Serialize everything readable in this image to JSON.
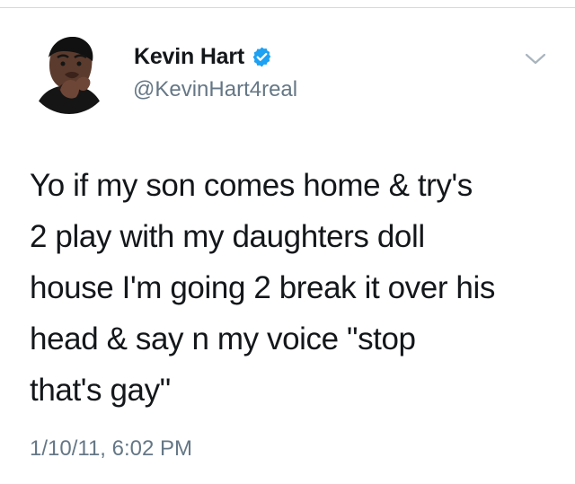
{
  "tweet": {
    "author": {
      "display_name": "Kevin Hart",
      "handle": "@KevinHart4real",
      "verified": true,
      "avatar_icon": "profile-photo-avatar"
    },
    "text": "Yo if my son comes home & try's\n2 play with my daughters doll\nhouse I'm going 2 break it over his\nhead & say n my voice \"stop\nthat's gay\"",
    "timestamp": "1/10/11, 6:02 PM",
    "icons": {
      "verified": "verified-badge-icon",
      "menu": "chevron-down-icon"
    },
    "colors": {
      "verified_badge": "#1da1f2",
      "secondary_text": "#657786",
      "primary_text": "#14171a"
    }
  }
}
